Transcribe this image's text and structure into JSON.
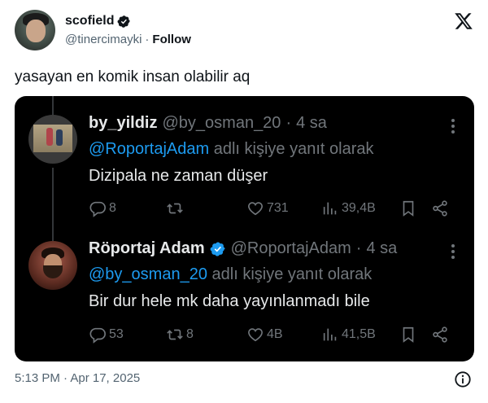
{
  "author": {
    "display_name": "scofield",
    "handle": "@tinercimayki",
    "separator": "·",
    "follow_label": "Follow"
  },
  "tweet": {
    "text": "yasayan en komik insan olabilir aq",
    "timestamp": "5:13 PM · Apr 17, 2025"
  },
  "screenshot": {
    "replies": [
      {
        "name": "by_yildiz",
        "handle": "@by_osman_20",
        "dot": "·",
        "time": "4 sa",
        "reply_mention": "@RoportajAdam",
        "reply_suffix": " adlı kişiye yanıt olarak",
        "body": "Dizipala ne zaman düşer",
        "verified": false,
        "stats": {
          "replies": "8",
          "retweets": "",
          "likes": "731",
          "views": "39,4B"
        }
      },
      {
        "name": "Röportaj Adam",
        "handle": "@RoportajAdam",
        "dot": "·",
        "time": "4 sa",
        "reply_mention": "@by_osman_20",
        "reply_suffix": " adlı kişiye yanıt olarak",
        "body": "Bir dur hele mk daha yayınlanmadı bile",
        "verified": true,
        "stats": {
          "replies": "53",
          "retweets": "8",
          "likes": "4B",
          "views": "41,5B"
        }
      }
    ]
  },
  "icons": {
    "verified": "verified-badge-icon",
    "logo": "x-logo-icon",
    "info": "info-icon",
    "more": "more-dots-icon",
    "reply": "reply-icon",
    "retweet": "retweet-icon",
    "like": "heart-icon",
    "views": "views-icon",
    "bookmark": "bookmark-icon",
    "share": "share-icon"
  },
  "colors": {
    "link": "#1d9bf0",
    "muted_dark": "#71767b",
    "text_dark": "#e7e9ea",
    "muted_light": "#536471"
  }
}
